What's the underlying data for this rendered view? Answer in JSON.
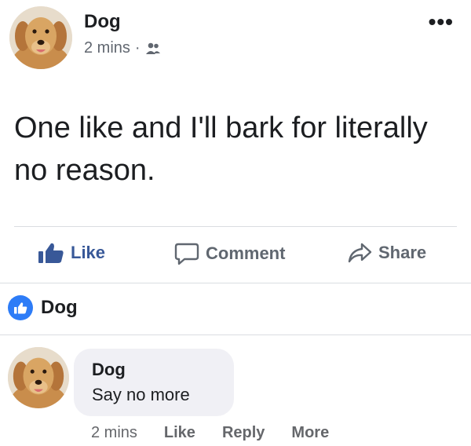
{
  "post": {
    "author": "Dog",
    "time": "2 mins",
    "separator": "·",
    "audience_icon": "friends-icon",
    "more_icon": "more-options-icon",
    "more_label": "•••",
    "text": "One like and I'll bark for literally no reason."
  },
  "actions": {
    "like_label": "Like",
    "comment_label": "Comment",
    "share_label": "Share",
    "like_icon": "thumbs-up-icon",
    "comment_icon": "speech-bubble-icon",
    "share_icon": "share-arrow-icon"
  },
  "reactions": {
    "icon": "like-reaction-icon",
    "reactor": "Dog"
  },
  "comment": {
    "author": "Dog",
    "text": "Say no more",
    "time": "2 mins",
    "like_label": "Like",
    "reply_label": "Reply",
    "more_label": "More"
  },
  "colors": {
    "like_blue": "#385898",
    "reaction_blue": "#2d7cf7",
    "secondary_text": "#616770",
    "bubble_bg": "#f0f0f5"
  }
}
